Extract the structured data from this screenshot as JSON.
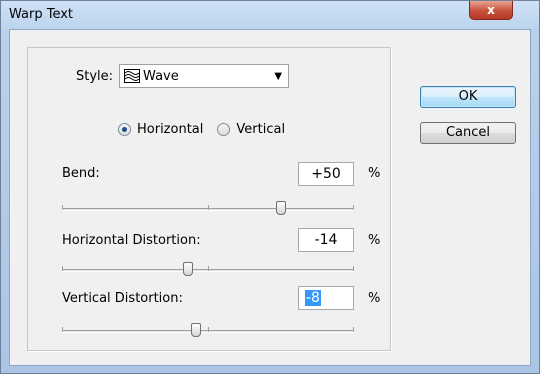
{
  "window": {
    "title": "Warp Text",
    "close_glyph": "x"
  },
  "style": {
    "label": "Style:",
    "value": "Wave",
    "icon": "wave-warp-icon"
  },
  "orientation": {
    "options": [
      "Horizontal",
      "Vertical"
    ],
    "selected": "Horizontal"
  },
  "bend": {
    "label": "Bend:",
    "value": "+50",
    "unit": "%",
    "percent": 50
  },
  "horizontal_distortion": {
    "label": "Horizontal Distortion:",
    "value": "-14",
    "unit": "%",
    "percent": -14
  },
  "vertical_distortion": {
    "label": "Vertical Distortion:",
    "value": "-8",
    "unit": "%",
    "percent": -8
  },
  "buttons": {
    "ok": "OK",
    "cancel": "Cancel"
  },
  "colors": {
    "selection": "#3399ff",
    "title_bar": "#bcd4ee",
    "close": "#c7503a"
  }
}
